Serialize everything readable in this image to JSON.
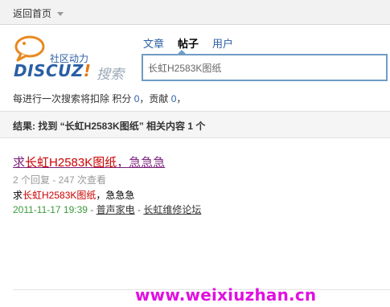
{
  "topbar": {
    "home_label": "返回首页"
  },
  "logo": {
    "slogan": "社区动力",
    "brand": "DISCUZ",
    "brand_mark": "!",
    "search_word": "搜索"
  },
  "tabs": [
    {
      "label": "文章",
      "active": false
    },
    {
      "label": "帖子",
      "active": true
    },
    {
      "label": "用户",
      "active": false
    }
  ],
  "search": {
    "value": "长虹H2583K图纸"
  },
  "points": {
    "prefix": "每进行一次搜索将扣除 积分",
    "credit_value": "0",
    "separator": "，贡献",
    "contrib_value": "0",
    "suffix": "，"
  },
  "result_header": {
    "text": "结果: 找到 “长虹H2583K图纸” 相关内容 1 个"
  },
  "result": {
    "title_prefix": "求",
    "title_highlight": "长虹H2583K图纸",
    "title_suffix": "，急急急",
    "meta": "2 个回复 - 247 次查看",
    "snippet_prefix": "求",
    "snippet_highlight": "长虹H2583K图纸",
    "snippet_suffix": "，急急急",
    "date": "2011-11-17 19:39",
    "sep1": " - ",
    "author": "普声家电",
    "sep2": " - ",
    "forum": "长虹维修论坛"
  },
  "watermark": "www.weixiuzhan.cn"
}
